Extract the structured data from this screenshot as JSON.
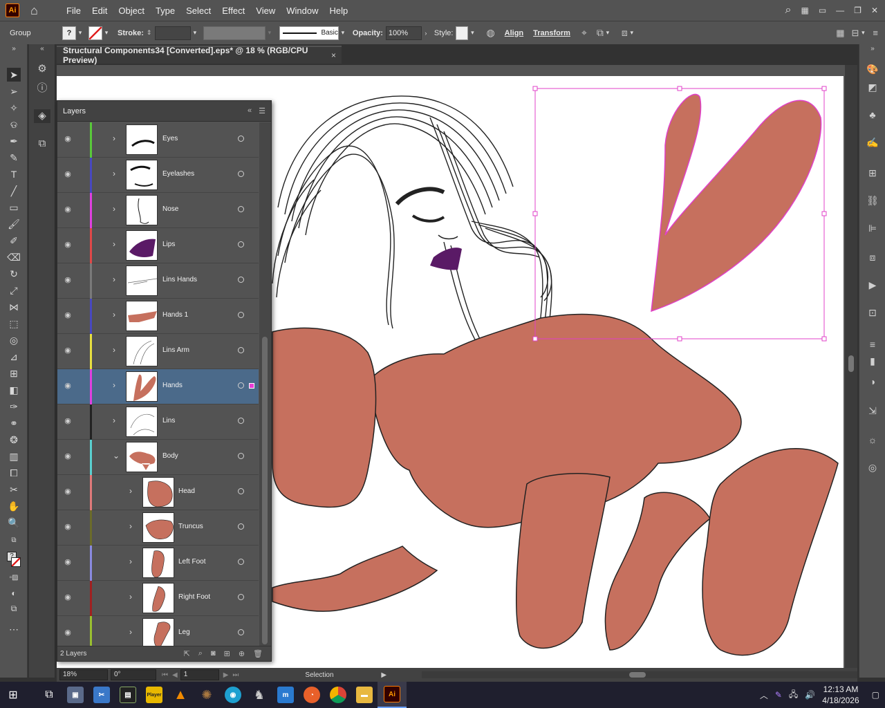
{
  "menubar": {
    "app_logo": "Ai",
    "items": [
      "File",
      "Edit",
      "Object",
      "Type",
      "Select",
      "Effect",
      "View",
      "Window",
      "Help"
    ]
  },
  "control": {
    "selection_type": "Group",
    "stroke_label": "Stroke:",
    "brush_label": "Basic",
    "opacity_label": "Opacity:",
    "opacity_value": "100%",
    "style_label": "Style:",
    "align_label": "Align",
    "transform_label": "Transform"
  },
  "document": {
    "tab_title": "Structural Components34 [Converted].eps* @ 18 % (RGB/CPU Preview)",
    "close_glyph": "×"
  },
  "layers_panel": {
    "title": "Layers",
    "footer_count": "2 Layers",
    "rows": [
      {
        "name": "Eyes",
        "color": "#59c93a",
        "expanded": false,
        "selected": false
      },
      {
        "name": "Eyelashes",
        "color": "#4848c0",
        "expanded": false,
        "selected": false
      },
      {
        "name": "Nose",
        "color": "#e040e0",
        "expanded": false,
        "selected": false
      },
      {
        "name": "Lips",
        "color": "#e04848",
        "expanded": false,
        "selected": false
      },
      {
        "name": "Lins Hands",
        "color": "#7a7a7a",
        "expanded": false,
        "selected": false
      },
      {
        "name": "Hands 1",
        "color": "#4848c0",
        "expanded": false,
        "selected": false
      },
      {
        "name": "Lins Arm",
        "color": "#e8e040",
        "expanded": false,
        "selected": false
      },
      {
        "name": "Hands",
        "color": "#e040e0",
        "expanded": false,
        "selected": true
      },
      {
        "name": "Lins",
        "color": "#222222",
        "expanded": false,
        "selected": false
      },
      {
        "name": "Body",
        "color": "#5ad0d0",
        "expanded": true,
        "selected": false
      },
      {
        "name": "Head",
        "color": "#e07a7a",
        "expanded": false,
        "selected": false
      },
      {
        "name": "Truncus",
        "color": "#6b6b2a",
        "expanded": false,
        "selected": false
      },
      {
        "name": "Left Foot",
        "color": "#8a8ae0",
        "expanded": false,
        "selected": false
      },
      {
        "name": "Right Foot",
        "color": "#a02020",
        "expanded": false,
        "selected": false
      },
      {
        "name": "Leg",
        "color": "#9ac030",
        "expanded": false,
        "selected": false
      }
    ]
  },
  "statusbar": {
    "zoom": "18%",
    "rotation": "0°",
    "artboard_number": "1",
    "tool_name": "Selection"
  },
  "taskbar": {
    "time": "12:13 AM",
    "date": "4/18/2026",
    "active_app_label": "Ai",
    "player_label": "Player"
  },
  "colors": {
    "skin": "#c6705e",
    "selection": "#e040c8",
    "lips": "#5a1a66"
  }
}
